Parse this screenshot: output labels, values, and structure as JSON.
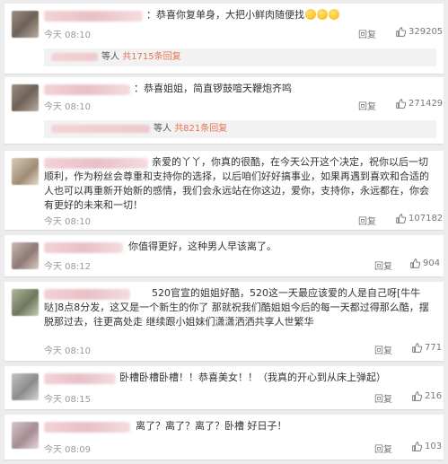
{
  "comments": [
    {
      "text": "：恭喜你复单身，大把小鲜肉随便找",
      "time": "今天 08:10",
      "reply": "回复",
      "likes": "329205",
      "sub_reply": {
        "suffix": "等人",
        "count": "共1715条回复"
      }
    },
    {
      "text": "：恭喜姐姐，简直锣鼓喧天鞭炮齐鸣",
      "time": "今天 08:10",
      "reply": "回复",
      "likes": "271429",
      "sub_reply": {
        "suffix": "等人",
        "count": "共821条回复"
      }
    },
    {
      "text": "亲爱的丫丫，你真的很酷，在今天公开这个决定，祝你以后一切顺利，作为粉丝会尊重和支持你的选择，以后咱们好好搞事业，如果再遇到喜欢和合适的人也可以再重新开始新的感情，我们会永远站在你这边，爱你，支持你，永远都在，你会有更好的未来和一切！",
      "time": "今天 08:10",
      "reply": "回复",
      "likes": "107182"
    },
    {
      "text": "你值得更好，这种男人早该离了。",
      "time": "今天 08:12",
      "reply": "回复",
      "likes": "904"
    },
    {
      "text": "520官宣的姐姐好酷，520这一天最应该爱的人是自己呀[牛牛哒]8点8分发，这又是一个新生的你了 那就祝我们酷姐姐今后的每一天都过得那么酷，摆脱那过去，往更高处走 继续跟小姐妹们潇潇洒洒共享人世繁华",
      "time": "今天 08:10",
      "reply": "回复",
      "likes": "771"
    },
    {
      "text": "卧槽卧槽卧槽！！恭喜美女！！（我真的开心到从床上弹起）",
      "time": "今天 08:15",
      "reply": "回复",
      "likes": "216"
    },
    {
      "text": "离了？离了？离了？卧槽 好日子！",
      "time": "今天 08:09",
      "reply": "回复",
      "likes": "103"
    }
  ],
  "icons": {
    "like": "thumbs-up-icon",
    "emoji": "laughing-emoji-icon"
  },
  "colors": {
    "reply_count": "#eb7350",
    "background": "#ececec"
  }
}
